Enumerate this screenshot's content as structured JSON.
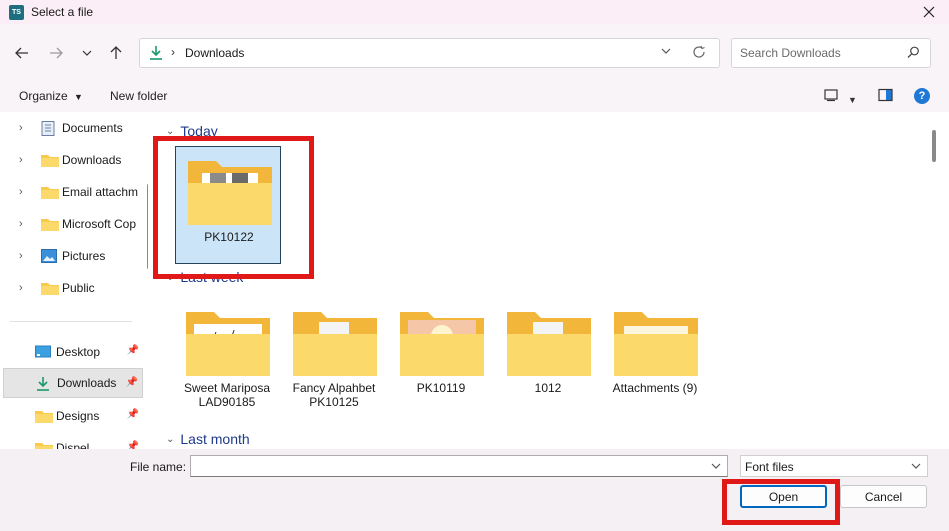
{
  "window": {
    "title": "Select a file",
    "app_icon_text": "TS"
  },
  "address": {
    "path": "Downloads"
  },
  "search": {
    "placeholder": "Search Downloads"
  },
  "toolbar": {
    "organize_label": "Organize",
    "new_folder_label": "New folder",
    "help_label": "?"
  },
  "sidebar": {
    "tree_items": [
      "Documents",
      "Downloads",
      "Email attachm",
      "Microsoft Cop",
      "Pictures",
      "Public"
    ],
    "quick_items": [
      "Desktop",
      "Downloads",
      "Designs",
      "Dispel"
    ]
  },
  "groups": {
    "today": {
      "label": "Today",
      "items": [
        {
          "name": "PK10122"
        }
      ]
    },
    "last_week": {
      "label": "Last week",
      "items": [
        {
          "name": "Sweet Mariposa LAD90185"
        },
        {
          "name": "Fancy Alpahbet PK10125"
        },
        {
          "name": "PK10119"
        },
        {
          "name": "1012"
        },
        {
          "name": "Attachments (9)"
        }
      ]
    },
    "last_month": {
      "label": "Last month"
    }
  },
  "footer": {
    "file_name_label": "File name:",
    "file_name_value": "",
    "file_type_value": "Font files",
    "open_label": "Open",
    "cancel_label": "Cancel"
  },
  "colors": {
    "accent": "#0067c0",
    "highlight": "#e01818",
    "folder": "#f8c94e",
    "group_header": "#1f3a8a"
  }
}
